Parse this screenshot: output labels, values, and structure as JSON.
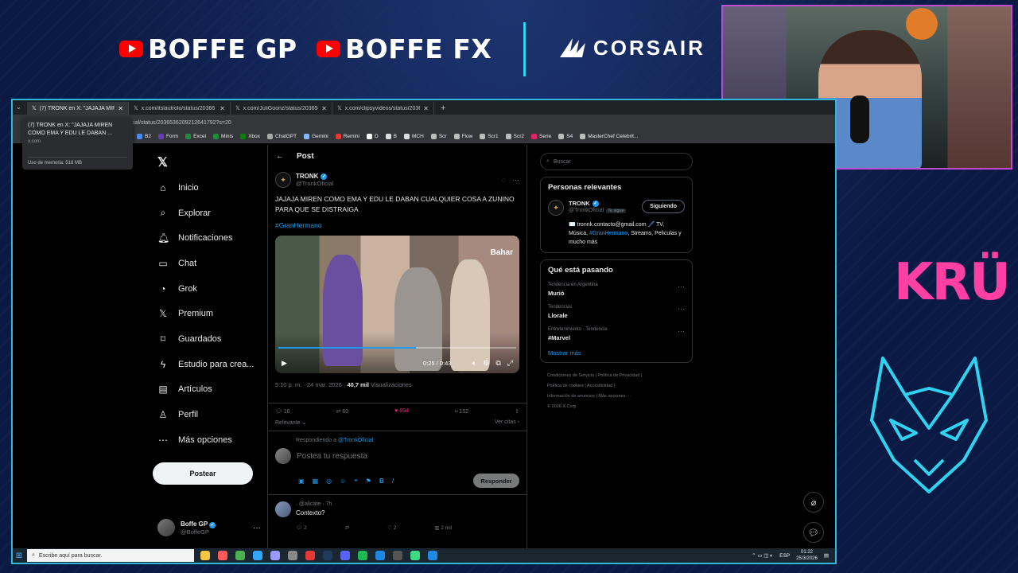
{
  "overlay": {
    "brand1": "BOFFE GP",
    "brand2": "BOFFE FX",
    "sponsor": "CORSAIR",
    "team_logo": "KRÜ",
    "accent_cyan": "#2fd3f0",
    "accent_pink": "#ff3fa3"
  },
  "browser": {
    "tabs": [
      {
        "label": "(7) TRONK en X: \"JAJAJA MIREN",
        "active": true
      },
      {
        "label": "x.com/itslautrolo/status/20366"
      },
      {
        "label": "x.com/JuliGoonz/status/203658"
      },
      {
        "label": "x.com/clipsyvideos/status/2036"
      }
    ],
    "url_partial": "ficial/status/2036536209212641792?s=20",
    "tooltip": {
      "title": "(7) TRONK en X: \"JAJAJA MIREN COMO EMA Y EDU LE DABAN ...",
      "domain": "x.com",
      "memory": "Uso de memoria: 518 MB"
    },
    "bookmarks": [
      "B2",
      "Form",
      "Excel",
      "Minis",
      "Xbox",
      "ChatGPT",
      "Gemini",
      "Remini",
      "D",
      "B",
      "MCH",
      "Scr",
      "Flow",
      "Scr1",
      "Scr2",
      "Serie",
      "S4",
      "MasterChef Celebrit..."
    ]
  },
  "nav": {
    "items": [
      "Inicio",
      "Explorar",
      "Notificaciones",
      "Chat",
      "Grok",
      "Premium",
      "Guardados",
      "Estudio para crea...",
      "Artículos",
      "Perfil",
      "Más opciones"
    ],
    "post_button": "Postear",
    "account": {
      "name": "Boffe GP",
      "handle": "@BoffeGP"
    }
  },
  "post": {
    "header": "Post",
    "author": "TRONK",
    "handle": "@TronkOficial",
    "text": "JAJAJA MIREN COMO EMA Y EDU LE DABAN CUALQUIER COSA A ZUNINO PARA QUE SE DISTRAIGA",
    "hashtag": "#GranHermano",
    "video": {
      "time": "0:25 / 0:43",
      "progress": 0.58,
      "brand": "Bahar"
    },
    "timestamp": "5:10 p. m. · 24 mar. 2026 ·",
    "views_count": "40,7 mil",
    "views_label": "Visualizaciones",
    "stats": {
      "replies": "16",
      "reposts": "60",
      "likes": "894",
      "bookmarks": "152"
    },
    "sort": "Relevante",
    "quotes": "Ver citas",
    "replying_to_label": "Respondiendo a",
    "replying_to_handle": "@TronkOficial",
    "reply_placeholder": "Postea tu respuesta",
    "reply_button": "Responder"
  },
  "reply": {
    "handle": ". @alicate · 7h",
    "text": "Contexto?",
    "stats": [
      "2",
      "",
      "2",
      "2 mil"
    ]
  },
  "sidebar": {
    "search_placeholder": "Buscar",
    "relevant_title": "Personas relevantes",
    "person": {
      "name": "TRONK",
      "handle": "@TronkOficial",
      "badge": "Te sigue",
      "follow_label": "Siguiendo",
      "bio_pre": "✉️ tronnk.contacto@gmail.com 🖊️ TV, Música, ",
      "bio_tag": "#GranHermano",
      "bio_post": ", Streams, Peliculas y mucho más"
    },
    "trends_title": "Qué está pasando",
    "trends": [
      {
        "context": "Tendencia en Argentina",
        "name": "Murió"
      },
      {
        "context": "Tendencias",
        "name": "Llorale"
      },
      {
        "context": "Entretenimiento · Tendencia",
        "name": "#Marvel"
      }
    ],
    "show_more": "Mostrar más",
    "footer": [
      "Condiciones de Servicio | Política de Privacidad |",
      "Política de cookies | Accesibilidad |",
      "Información de anuncios | Más opciones ···",
      "© 2026 X Corp."
    ]
  },
  "taskbar": {
    "search": "Escribe aquí para buscar.",
    "lang": "ESP",
    "time": "01:22",
    "date": "25/3/2026"
  }
}
